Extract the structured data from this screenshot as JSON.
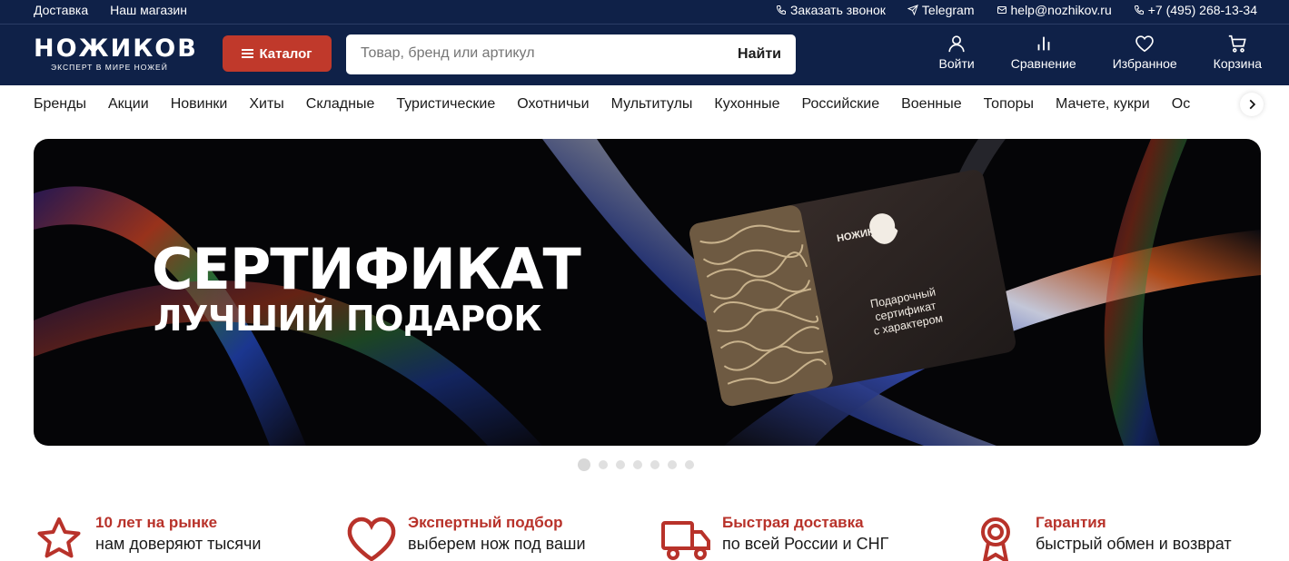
{
  "topbar": {
    "left_links": [
      "Доставка",
      "Наш магазин"
    ],
    "callback": "Заказать звонок",
    "telegram": "Telegram",
    "email": "help@nozhikov.ru",
    "phone": "+7 (495) 268-13-34"
  },
  "header": {
    "logo_main": "НОЖИКОВ",
    "logo_sub": "эксперт в мире ножей",
    "catalog_label": "Каталог",
    "search_placeholder": "Товар, бренд или артикул",
    "search_button": "Найти",
    "icons": [
      {
        "label": "Войти",
        "icon": "user-icon"
      },
      {
        "label": "Сравнение",
        "icon": "compare-icon"
      },
      {
        "label": "Избранное",
        "icon": "heart-icon"
      },
      {
        "label": "Корзина",
        "icon": "cart-icon"
      }
    ]
  },
  "nav": {
    "items": [
      "Бренды",
      "Акции",
      "Новинки",
      "Хиты",
      "Складные",
      "Туристические",
      "Охотничьи",
      "Мультитулы",
      "Кухонные",
      "Российские",
      "Военные",
      "Топоры",
      "Мачете, кукри",
      "Ос"
    ]
  },
  "banner": {
    "title": "СЕРТИФИКАТ",
    "subtitle": "ЛУЧШИЙ ПОДАРОК",
    "card_brand": "НОЖИКОВ",
    "card_text_1": "Подарочный",
    "card_text_2": "сертификат",
    "card_text_3": "с характером"
  },
  "slider": {
    "count": 7,
    "active": 0
  },
  "features": [
    {
      "icon": "star-icon",
      "title": "10 лет на рынке",
      "desc": "нам доверяют тысячи"
    },
    {
      "icon": "heart-outline-icon",
      "title": "Экспертный подбор",
      "desc": "выберем нож под ваши"
    },
    {
      "icon": "truck-icon",
      "title": "Быстрая доставка",
      "desc": "по всей России и СНГ"
    },
    {
      "icon": "medal-icon",
      "title": "Гарантия",
      "desc": "быстрый обмен и возврат"
    }
  ],
  "colors": {
    "navy": "#0f2148",
    "accent": "#c0392b",
    "feature_title": "#b8322a"
  }
}
